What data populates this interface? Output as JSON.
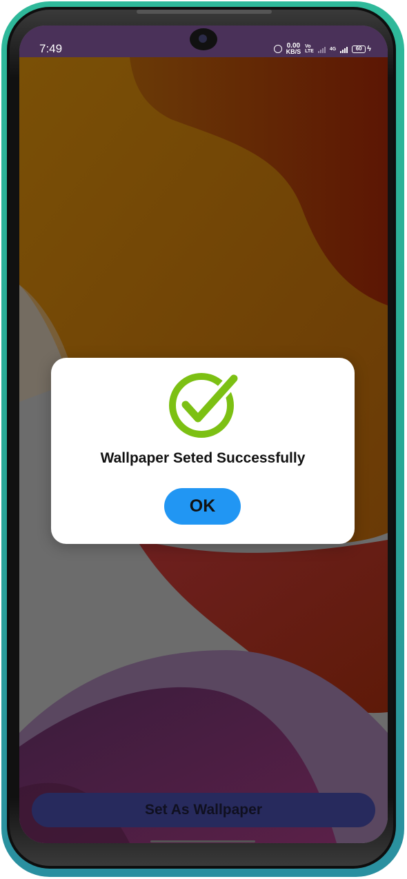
{
  "status_bar": {
    "time": "7:49",
    "speed_value": "0.00",
    "speed_unit": "KB/S",
    "volte_top": "Vo",
    "volte_bottom": "LTE",
    "network": "4G",
    "battery": "60"
  },
  "dialog": {
    "icon": "check-circle-icon",
    "message": "Wallpaper Seted Successfully",
    "ok_label": "OK",
    "icon_color": "#7cc013",
    "button_color": "#2196f3"
  },
  "bottom_action": {
    "label": "Set As Wallpaper"
  }
}
